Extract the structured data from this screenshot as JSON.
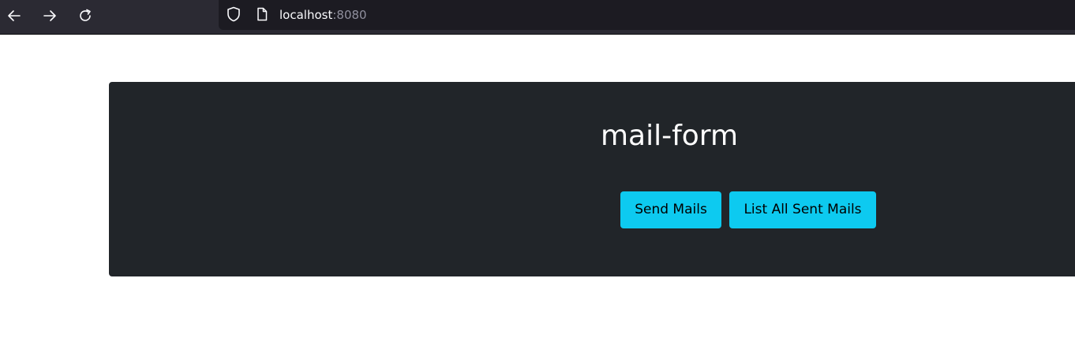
{
  "browser": {
    "url_host": "localhost",
    "url_port": ":8080",
    "icons": {
      "back": "arrow-left-icon",
      "forward": "arrow-right-icon",
      "reload": "reload-icon",
      "security": "shield-icon",
      "page": "page-icon"
    }
  },
  "main": {
    "title": "mail-form",
    "buttons": {
      "send_label": "Send Mails",
      "list_label": "List All Sent Mails"
    }
  },
  "colors": {
    "browser_chrome": "#2b2a33",
    "url_bar": "#1c1b22",
    "jumbotron_bg": "#212529",
    "button_bg": "#0dcaf0",
    "title_text": "#ffffff"
  }
}
